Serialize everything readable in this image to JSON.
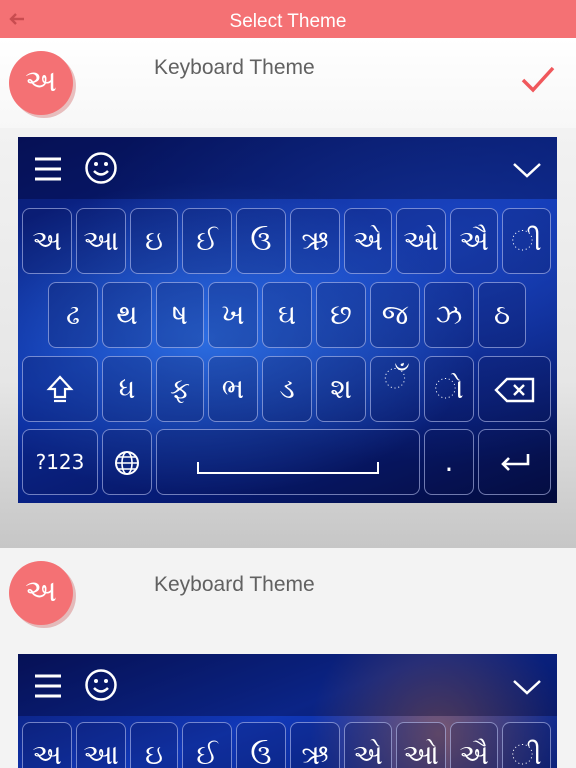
{
  "header": {
    "title": "Select Theme",
    "back_icon": "back-arrow-icon"
  },
  "logo_char": "અ",
  "cards": [
    {
      "title": "Keyboard Theme",
      "selected": true
    },
    {
      "title": "Keyboard Theme",
      "selected": false
    }
  ],
  "keyboard": {
    "row1": [
      "અ",
      "આ",
      "ઇ",
      "ઈ",
      "ઉ",
      "ઋ",
      "એ",
      "ઓ",
      "ઐ",
      "ી"
    ],
    "row2": [
      "ઢ",
      "થ",
      "ષ",
      "ખ",
      "ઘ",
      "છ",
      "જ",
      "ઝ",
      "ઠ"
    ],
    "row3": [
      "ધ",
      "ફ",
      "ભ",
      "ડ",
      "શ",
      "ઁ",
      "ો"
    ],
    "bottom": {
      "numbers": "?123",
      "period": "."
    }
  },
  "colors": {
    "accent": "#f47174",
    "keyboard_bg": "#0b2fa8"
  }
}
